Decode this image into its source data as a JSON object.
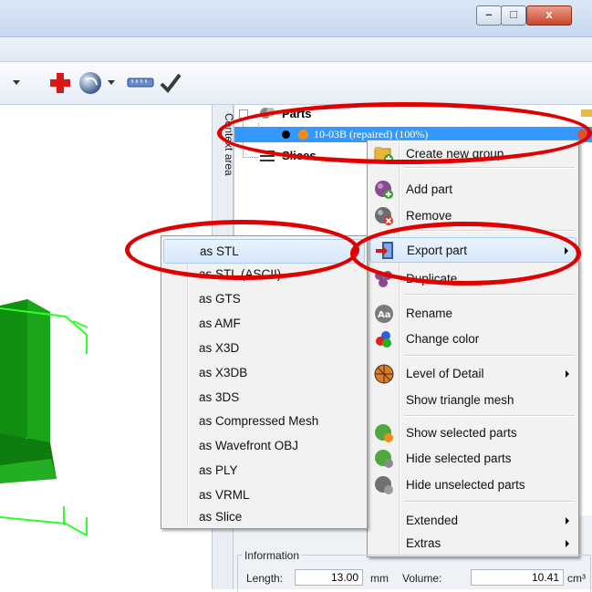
{
  "window": {
    "controls": {
      "minimize": "–",
      "maximize": "□",
      "close": "x"
    }
  },
  "context_area_label": "Context area",
  "tree": {
    "parts_label": "Parts",
    "part_item": "10-03B (repaired) (100%)",
    "slices_label": "Slices"
  },
  "context_menu": {
    "items": [
      {
        "label": "Create new group",
        "icon": "folder-add-icon"
      },
      {
        "label": "Add part",
        "icon": "add-part-icon"
      },
      {
        "label": "Remove",
        "icon": "remove-part-icon"
      },
      {
        "label": "Export part",
        "icon": "export-icon"
      },
      {
        "label": "Duplicate",
        "icon": "duplicate-icon"
      },
      {
        "label": "Rename",
        "icon": "rename-icon"
      },
      {
        "label": "Change color",
        "icon": "color-icon"
      },
      {
        "label": "Level of Detail",
        "icon": "level-of-detail-icon"
      },
      {
        "label": "Show triangle mesh",
        "icon": ""
      },
      {
        "label": "Show selected parts",
        "icon": "show-parts-icon"
      },
      {
        "label": "Hide selected parts",
        "icon": "hide-parts-icon"
      },
      {
        "label": "Hide unselected parts",
        "icon": "hide-unselected-icon"
      },
      {
        "label": "Extended",
        "icon": ""
      },
      {
        "label": "Extras",
        "icon": ""
      }
    ]
  },
  "export_submenu": {
    "items": [
      "as STL",
      "as STL (ASCII)",
      "as GTS",
      "as AMF",
      "as X3D",
      "as X3DB",
      "as 3DS",
      "as Compressed Mesh",
      "as Wavefront OBJ",
      "as PLY",
      "as VRML",
      "as Slice"
    ]
  },
  "info": {
    "group_label": "Information",
    "length_label": "Length:",
    "length_value": "13.00",
    "length_unit": "mm",
    "volume_label": "Volume:",
    "volume_value": "10.41",
    "volume_unit": "cm³"
  },
  "colors": {
    "highlight_blue": "#3399ff",
    "annotation_red": "#e00000",
    "model_green": "#22aa22"
  }
}
